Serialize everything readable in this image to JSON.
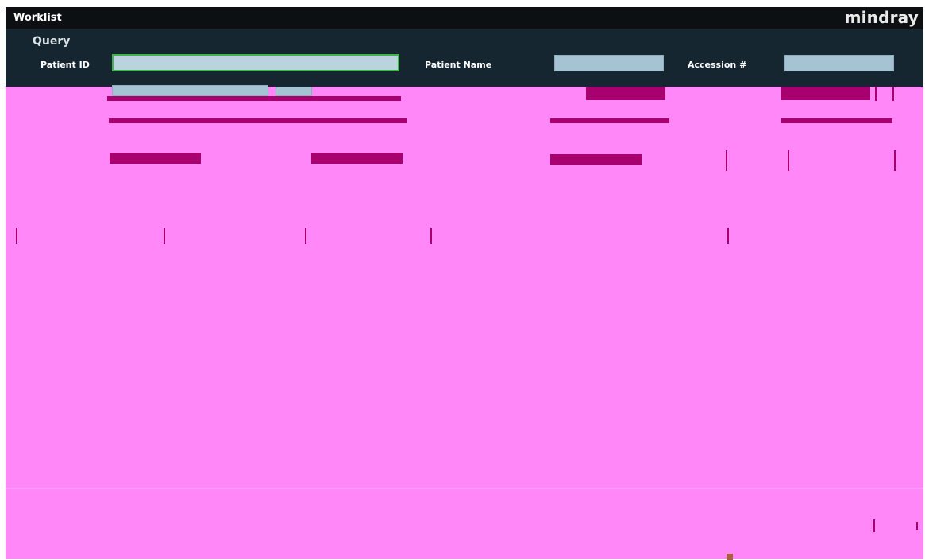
{
  "window": {
    "title": "Worklist",
    "brand": "mindray"
  },
  "query": {
    "title": "Query",
    "patient_id_label": "Patient ID",
    "patient_id_value": "",
    "patient_name_label": "Patient Name",
    "patient_name_value": "",
    "accession_label": "Accession #",
    "accession_value": ""
  },
  "colors": {
    "title_bar": "#0c1012",
    "query_panel": "#152630",
    "field": "#a6c3d3",
    "active_border": "#3fb54a",
    "garbled_region": "#ff87f8"
  }
}
